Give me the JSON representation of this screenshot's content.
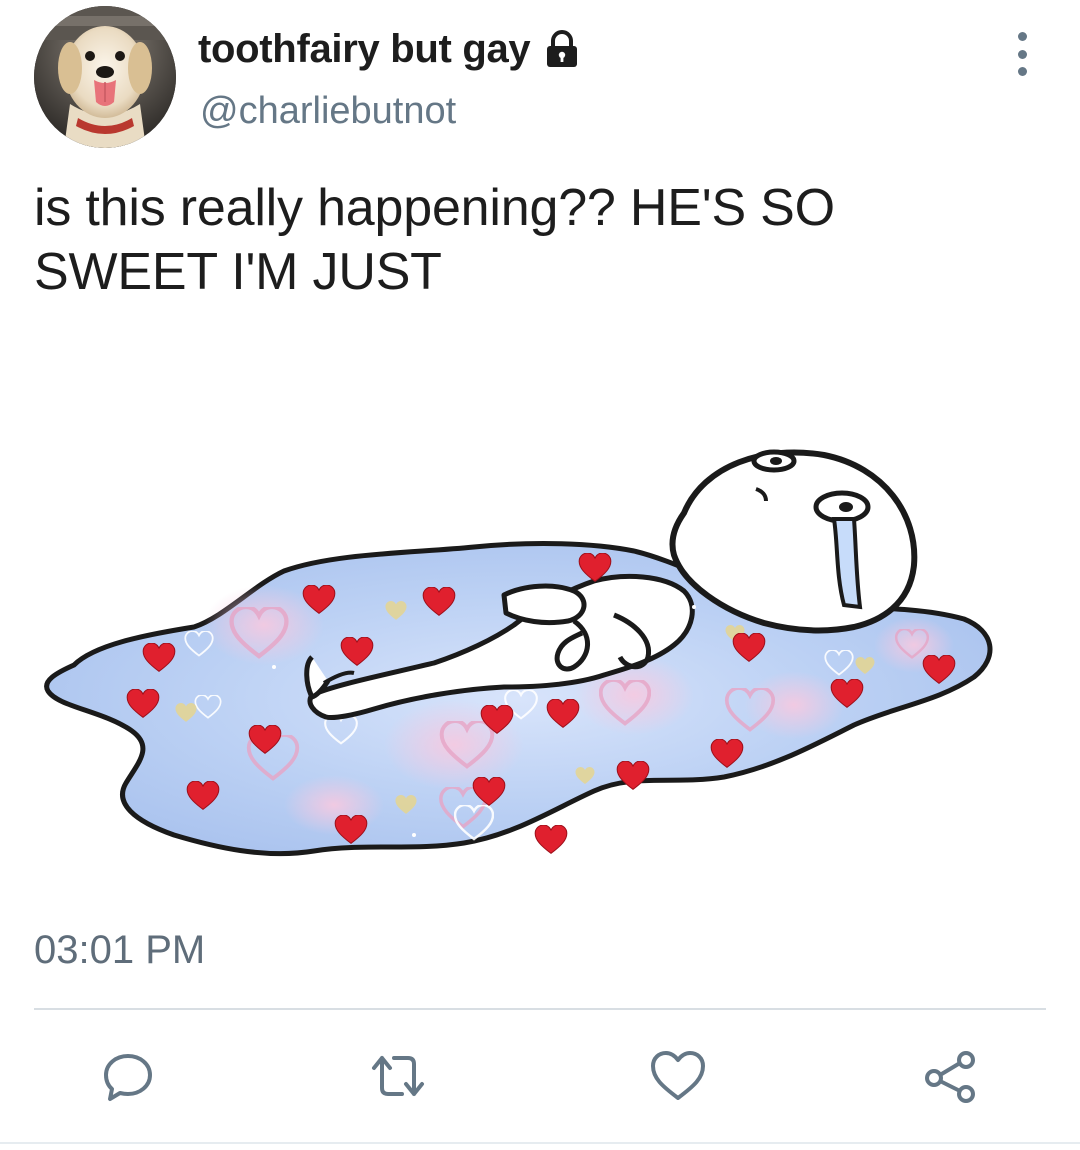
{
  "tweet": {
    "display_name": "toothfairy but gay",
    "protected_icon": "lock-icon",
    "handle": "@charliebutnot",
    "text": "is this really happening?? HE'S SO\nSWEET I'M JUST",
    "timestamp": "03:01 PM",
    "avatar": "golden-retriever-photo",
    "media": "meme-crying-stick-figure-in-heart-puddle",
    "menu_icon": "more-vertical-icon"
  },
  "actions": [
    {
      "name": "reply",
      "icon": "reply-icon"
    },
    {
      "name": "retweet",
      "icon": "retweet-icon"
    },
    {
      "name": "like",
      "icon": "heart-icon"
    },
    {
      "name": "share",
      "icon": "share-icon"
    }
  ],
  "colors": {
    "text_primary": "#1d1d1d",
    "text_secondary": "#657786",
    "icon_gray": "#657786",
    "divider": "#d8dee3",
    "heart_red": "#e0202e",
    "puddle_blue": "#b9cff3"
  }
}
